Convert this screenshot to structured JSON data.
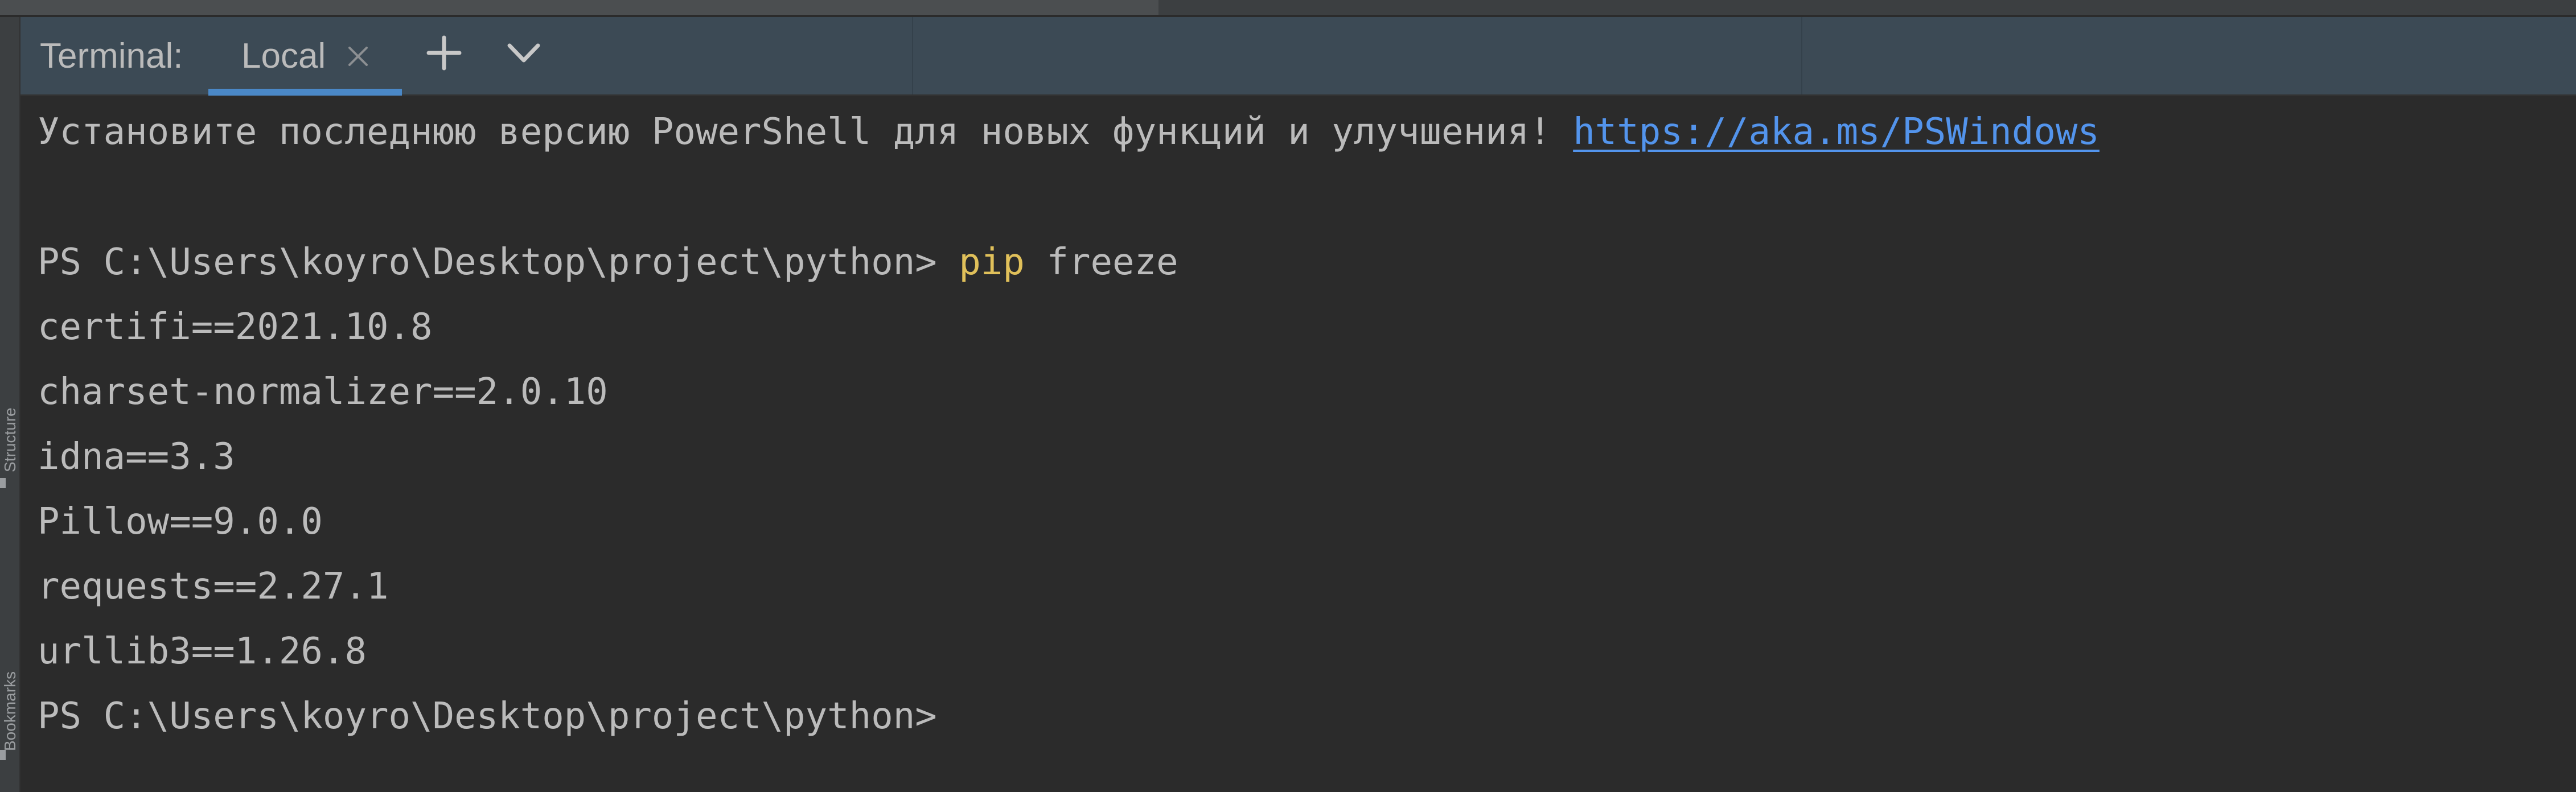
{
  "tool_window": {
    "title": "Terminal:",
    "tabs": [
      {
        "label": "Local",
        "active": true
      }
    ],
    "new_tab_icon": "plus-icon",
    "tab_menu_icon": "chevron-down-icon",
    "close_icon": "close-icon"
  },
  "side_strip": {
    "labels": [
      "Structure",
      "Bookmarks"
    ]
  },
  "terminal": {
    "banner_text": "Установите последнюю версию PowerShell для новых функций и улучшения! ",
    "banner_link": "https://aka.ms/PSWindows",
    "prompt": "PS C:\\Users\\koyro\\Desktop\\project\\python> ",
    "command_keyword": "pip",
    "command_args": " freeze",
    "output": [
      "certifi==2021.10.8",
      "charset-normalizer==2.0.10",
      "idna==3.3",
      "Pillow==9.0.0",
      "requests==2.27.1",
      "urllib3==1.26.8"
    ],
    "final_prompt": "PS C:\\Users\\koyro\\Desktop\\project\\python>"
  },
  "colors": {
    "background": "#2b2b2b",
    "header": "#3c4a55",
    "text": "#bbbbbb",
    "keyword": "#e0c05a",
    "link": "#5394ec",
    "tab_accent": "#4a88c7"
  }
}
